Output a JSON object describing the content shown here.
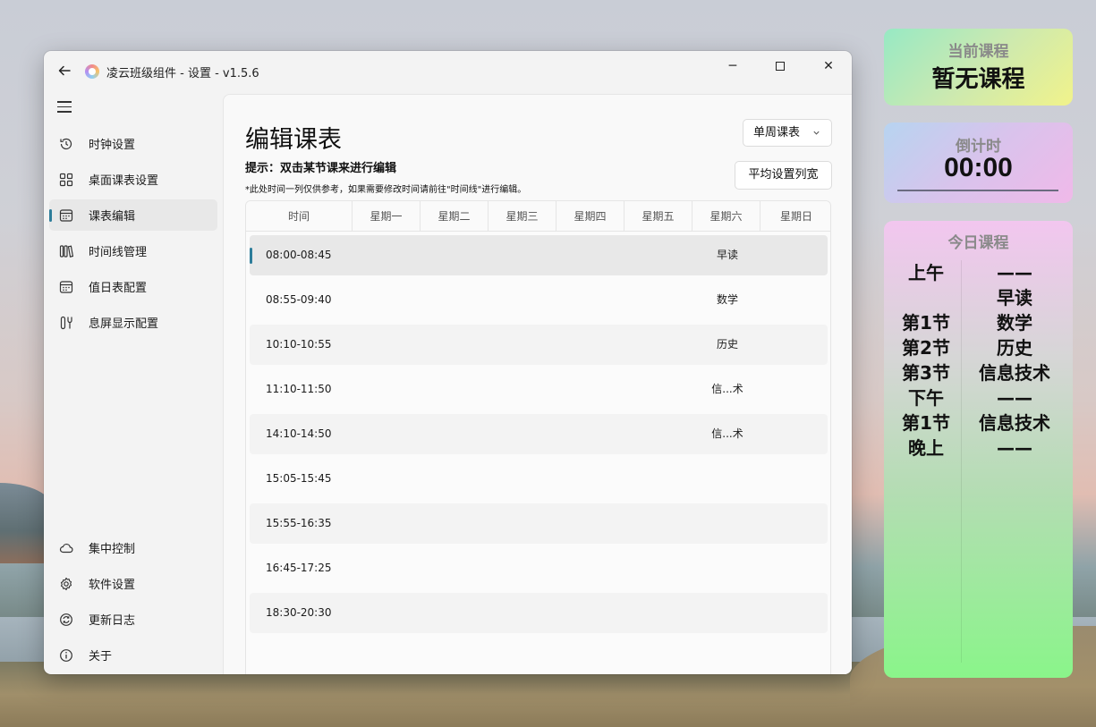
{
  "window": {
    "title": "凌云班级组件 - 设置 - v1.5.6",
    "back_icon": "arrow-left-icon",
    "controls": {
      "minimize": "─",
      "close": "✕"
    }
  },
  "sidebar": {
    "items": [
      {
        "label": "时钟设置",
        "icon": "history-clock-icon"
      },
      {
        "label": "桌面课表设置",
        "icon": "grid-apps-icon"
      },
      {
        "label": "课表编辑",
        "icon": "calendar-icon",
        "active": true
      },
      {
        "label": "时间线管理",
        "icon": "library-icon"
      },
      {
        "label": "值日表配置",
        "icon": "calendar-icon"
      },
      {
        "label": "息屏显示配置",
        "icon": "tools-icon"
      }
    ],
    "bottom_items": [
      {
        "label": "集中控制",
        "icon": "cloud-icon"
      },
      {
        "label": "软件设置",
        "icon": "gear-icon"
      },
      {
        "label": "更新日志",
        "icon": "sync-icon"
      },
      {
        "label": "关于",
        "icon": "info-icon"
      }
    ]
  },
  "content": {
    "title": "编辑课表",
    "hint": "提示：双击某节课来进行编辑",
    "note": "*此处时间一列仅供参考，如果需要修改时间请前往\"时间线\"进行编辑。",
    "week_select": "单周课表",
    "avg_button": "平均设置列宽",
    "table": {
      "headers": [
        "时间",
        "星期一",
        "星期二",
        "星期三",
        "星期四",
        "星期五",
        "星期六",
        "星期日"
      ],
      "rows": [
        {
          "time": "08:00-08:45",
          "sat": "早读"
        },
        {
          "time": "08:55-09:40",
          "sat": "数学"
        },
        {
          "time": "10:10-10:55",
          "sat": "历史"
        },
        {
          "time": "11:10-11:50",
          "sat": "信...术"
        },
        {
          "time": "14:10-14:50",
          "sat": "信...术"
        },
        {
          "time": "15:05-15:45",
          "sat": ""
        },
        {
          "time": "15:55-16:35",
          "sat": ""
        },
        {
          "time": "16:45-17:25",
          "sat": ""
        },
        {
          "time": "18:30-20:30",
          "sat": ""
        }
      ]
    }
  },
  "widgets": {
    "current": {
      "label": "当前课程",
      "value": "暂无课程"
    },
    "countdown": {
      "label": "倒计时",
      "value": "00:00"
    },
    "today": {
      "label": "今日课程",
      "left": [
        "上午",
        "",
        "第1节",
        "第2节",
        "第3节",
        "下午",
        "第1节",
        "晚上"
      ],
      "right": [
        "——",
        "早读",
        "数学",
        "历史",
        "信息技术",
        "——",
        "信息技术",
        "——"
      ]
    }
  }
}
